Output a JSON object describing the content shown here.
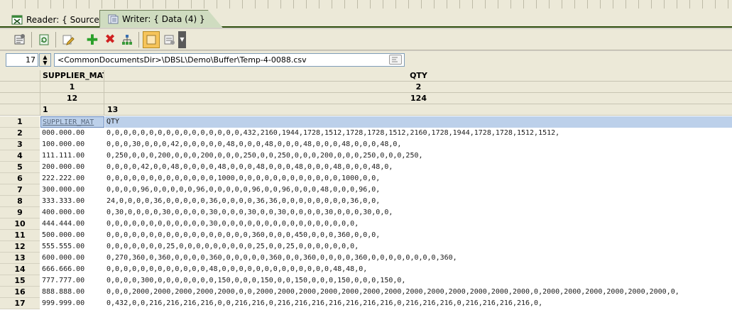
{
  "tabs": [
    {
      "label": "Reader: { Source }"
    },
    {
      "label": "Writer: { Data (4) }"
    }
  ],
  "toolbar": {
    "icons": [
      "properties-icon",
      "refresh-icon",
      "edit-icon",
      "add-icon",
      "delete-icon",
      "hierarchy-icon",
      "view-icon",
      "options-icon"
    ]
  },
  "path_bar": {
    "row_number": "17",
    "path": "<CommonDocumentsDir>\\DBSL\\Demo\\Buffer\\Temp-4-0088.csv"
  },
  "header": {
    "names": [
      "SUPPLIER_MAT",
      "QTY"
    ],
    "indexes": [
      "1",
      "2"
    ],
    "widths": [
      "12",
      "124"
    ],
    "positions": [
      "1",
      "13"
    ]
  },
  "rows": [
    {
      "n": "1",
      "a": "SUPPLIER_MAT",
      "b": "QTY"
    },
    {
      "n": "2",
      "a": "000.000.00",
      "b": "0,0,0,0,0,0,0,0,0,0,0,0,0,0,0,0,432,2160,1944,1728,1512,1728,1728,1512,2160,1728,1944,1728,1728,1512,1512,"
    },
    {
      "n": "3",
      "a": "100.000.00",
      "b": "0,0,0,30,0,0,0,42,0,0,0,0,0,48,0,0,0,48,0,0,0,48,0,0,0,48,0,0,0,48,0,"
    },
    {
      "n": "4",
      "a": "111.111.00",
      "b": "0,250,0,0,0,200,0,0,0,200,0,0,0,250,0,0,250,0,0,0,200,0,0,0,250,0,0,0,250,"
    },
    {
      "n": "5",
      "a": "200.000.00",
      "b": "0,0,0,0,42,0,0,48,0,0,0,0,48,0,0,0,48,0,0,0,48,0,0,0,48,0,0,0,48,0,"
    },
    {
      "n": "6",
      "a": "222.222.00",
      "b": "0,0,0,0,0,0,0,0,0,0,0,0,0,1000,0,0,0,0,0,0,0,0,0,0,0,0,1000,0,0,"
    },
    {
      "n": "7",
      "a": "300.000.00",
      "b": "0,0,0,0,96,0,0,0,0,0,96,0,0,0,0,0,96,0,0,96,0,0,0,48,0,0,0,96,0,"
    },
    {
      "n": "8",
      "a": "333.333.00",
      "b": "24,0,0,0,0,36,0,0,0,0,0,36,0,0,0,0,36,36,0,0,0,0,0,0,0,0,36,0,0,"
    },
    {
      "n": "9",
      "a": "400.000.00",
      "b": "0,30,0,0,0,0,30,0,0,0,0,30,0,0,0,30,0,0,30,0,0,0,0,30,0,0,0,30,0,0,"
    },
    {
      "n": "10",
      "a": "444.444.00",
      "b": "0,0,0,0,0,0,0,0,0,0,0,0,30,0,0,0,0,0,0,0,0,0,0,0,0,0,0,0,0,"
    },
    {
      "n": "11",
      "a": "500.000.00",
      "b": "0,0,0,0,0,0,0,0,0,0,0,0,0,0,0,0,0,360,0,0,0,450,0,0,0,360,0,0,0,"
    },
    {
      "n": "12",
      "a": "555.555.00",
      "b": "0,0,0,0,0,0,0,25,0,0,0,0,0,0,0,0,0,25,0,0,25,0,0,0,0,0,0,0,"
    },
    {
      "n": "13",
      "a": "600.000.00",
      "b": "0,270,360,0,360,0,0,0,0,360,0,0,0,0,0,360,0,0,360,0,0,0,0,360,0,0,0,0,0,0,0,0,360,"
    },
    {
      "n": "14",
      "a": "666.666.00",
      "b": "0,0,0,0,0,0,0,0,0,0,0,0,48,0,0,0,0,0,0,0,0,0,0,0,0,0,48,48,0,"
    },
    {
      "n": "15",
      "a": "777.777.00",
      "b": "0,0,0,0,300,0,0,0,0,0,0,0,150,0,0,0,150,0,0,150,0,0,0,150,0,0,0,150,0,"
    },
    {
      "n": "16",
      "a": "888.888.00",
      "b": "0,0,0,2000,2000,2000,2000,2000,0,0,2000,2000,2000,2000,2000,2000,2000,2000,2000,2000,2000,2000,2000,0,2000,2000,2000,2000,2000,2000,0,"
    },
    {
      "n": "17",
      "a": "999.999.00",
      "b": "0,432,0,0,216,216,216,216,0,0,216,216,0,216,216,216,216,216,216,216,0,216,216,216,0,216,216,216,216,0,"
    }
  ]
}
